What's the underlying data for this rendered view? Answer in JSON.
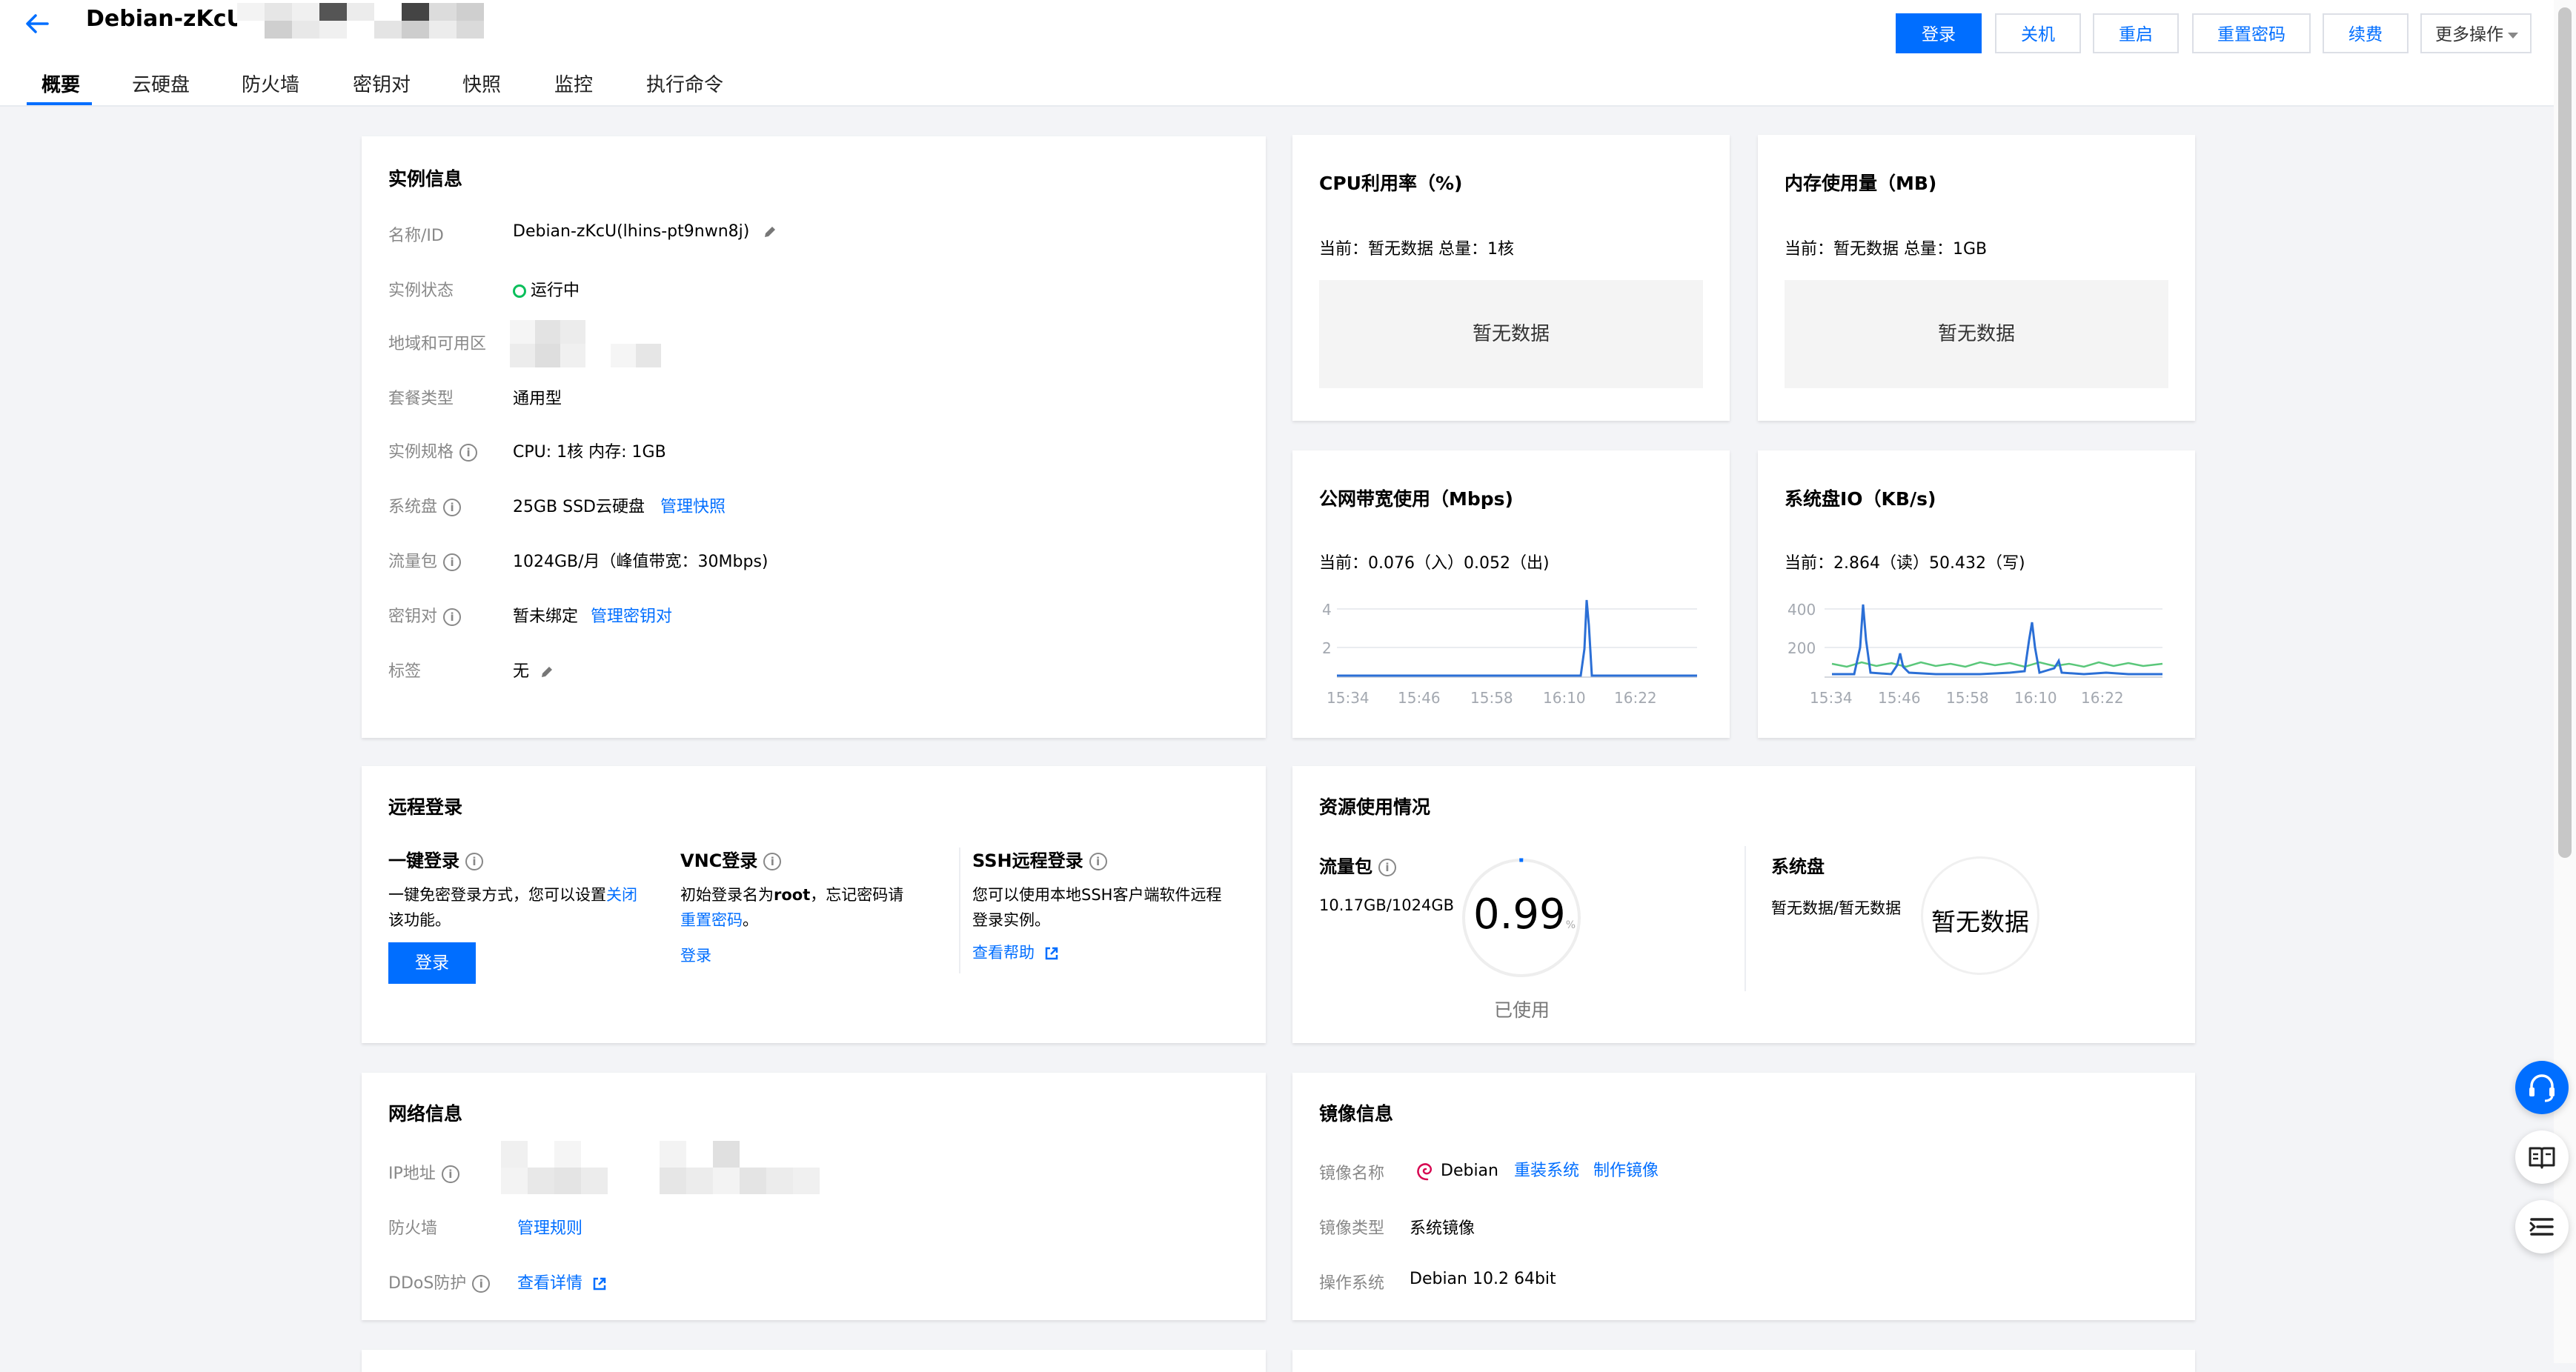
{
  "header": {
    "instance_title": "Debian-zKcU",
    "buttons": {
      "login": "登录",
      "shutdown": "关机",
      "restart": "重启",
      "reset_password": "重置密码",
      "renew": "续费",
      "more": "更多操作"
    }
  },
  "tabs": [
    "概要",
    "云硬盘",
    "防火墙",
    "密钥对",
    "快照",
    "监控",
    "执行命令"
  ],
  "instance_info": {
    "title": "实例信息",
    "name_label": "名称/ID",
    "name_value": "Debian-zKcU(lhins-pt9nwn8j)",
    "status_label": "实例状态",
    "status_value": "运行中",
    "region_label": "地域和可用区",
    "plan_label": "套餐类型",
    "plan_value": "通用型",
    "spec_label": "实例规格",
    "spec_value": "CPU: 1核 内存: 1GB",
    "disk_label": "系统盘",
    "disk_value": "25GB SSD云硬盘",
    "disk_link": "管理快照",
    "traffic_label": "流量包",
    "traffic_value": "1024GB/月（峰值带宽：30Mbps)",
    "keypair_label": "密钥对",
    "keypair_value": "暂未绑定",
    "keypair_link": "管理密钥对",
    "tag_label": "标签",
    "tag_value": "无"
  },
  "cpu_card": {
    "title": "CPU利用率（%)",
    "current": "当前：暂无数据 总量：1核",
    "nodata": "暂无数据"
  },
  "mem_card": {
    "title": "内存使用量（MB)",
    "current": "当前：暂无数据 总量：1GB",
    "nodata": "暂无数据"
  },
  "bandwidth_card": {
    "title": "公网带宽使用（Mbps)",
    "current": "当前：0.076（入）0.052（出)",
    "y_ticks": [
      "4",
      "2"
    ],
    "x_ticks": [
      "15:34",
      "15:46",
      "15:58",
      "16:10",
      "16:22"
    ]
  },
  "diskio_card": {
    "title": "系统盘IO（KB/s)",
    "current": "当前：2.864（读）50.432（写)",
    "y_ticks": [
      "400",
      "200"
    ],
    "x_ticks": [
      "15:34",
      "15:46",
      "15:58",
      "16:10",
      "16:22"
    ]
  },
  "remote_login": {
    "title": "远程登录",
    "one_click": {
      "title": "一键登录",
      "desc_1": "一键免密登录方式，您可以设置",
      "desc_link": "关闭",
      "desc_2": "该功能。",
      "button": "登录"
    },
    "vnc": {
      "title": "VNC登录",
      "desc_1": "初始登录名为",
      "desc_user": "root",
      "desc_2": "，忘记密码请",
      "desc_link": "重置密码",
      "desc_3": "。",
      "link": "登录"
    },
    "ssh": {
      "title": "SSH远程登录",
      "desc_1": "您可以使用本地SSH客户端软件远程",
      "desc_2": "登录实例。",
      "link": "查看帮助"
    }
  },
  "resource_usage": {
    "title": "资源使用情况",
    "traffic": {
      "title": "流量包",
      "value": "10.17GB/1024GB",
      "percent": "0.99",
      "unit": "%",
      "used": "已使用"
    },
    "sysdisk": {
      "title": "系统盘",
      "value": "暂无数据/暂无数据",
      "circle": "暂无数据"
    }
  },
  "network_info": {
    "title": "网络信息",
    "ip_label": "IP地址",
    "firewall_label": "防火墙",
    "firewall_link": "管理规则",
    "ddos_label": "DDoS防护",
    "ddos_link": "查看详情"
  },
  "image_info": {
    "title": "镜像信息",
    "name_label": "镜像名称",
    "name_value": "Debian",
    "reinstall_link": "重装系统",
    "make_image_link": "制作镜像",
    "type_label": "镜像类型",
    "type_value": "系统镜像",
    "os_label": "操作系统",
    "os_value": "Debian 10.2 64bit"
  },
  "colors": {
    "primary": "#006eff",
    "running": "#0abf5b",
    "write_series": "#5ac77a",
    "read_series": "#2b6fd6"
  }
}
